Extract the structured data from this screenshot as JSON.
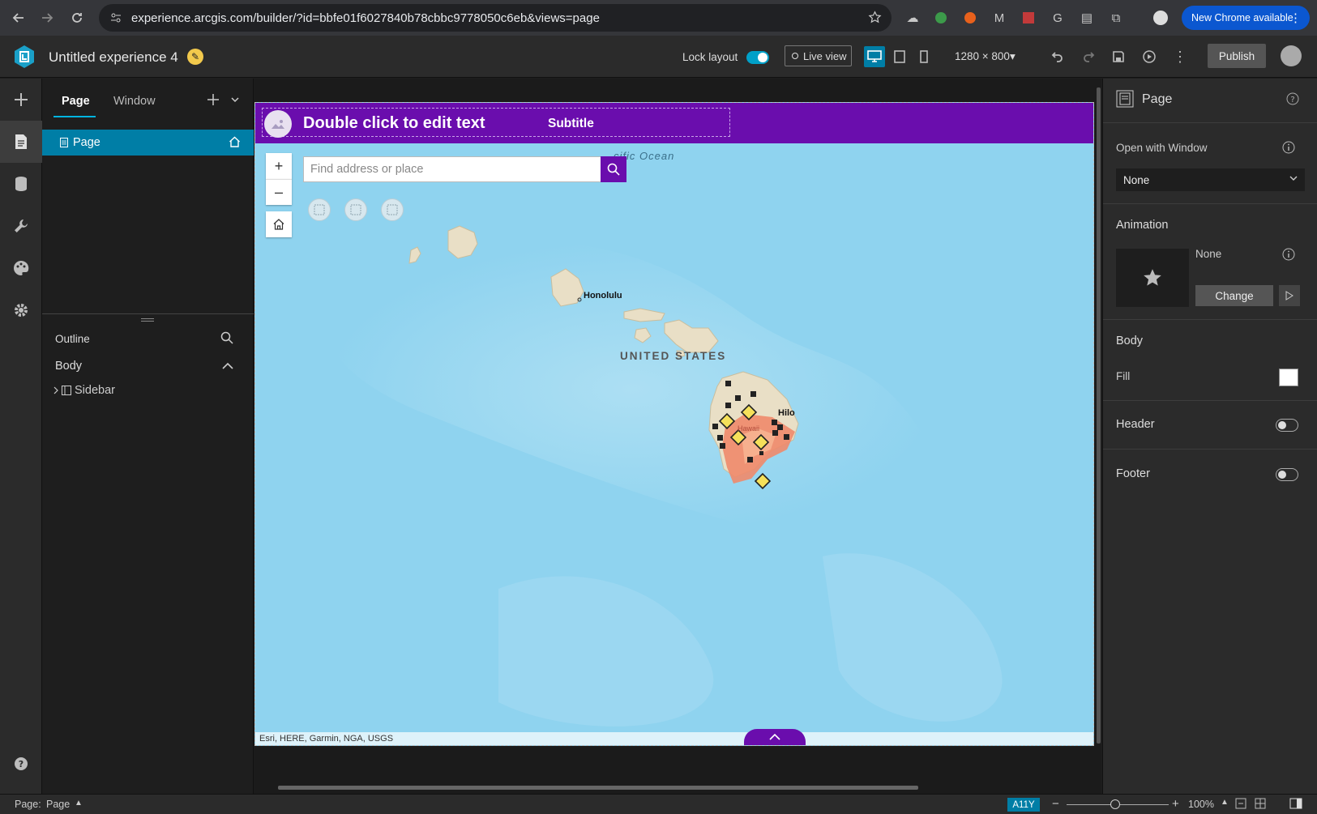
{
  "browser": {
    "url": "experience.arcgis.com/builder/?id=bbfe01f6027840b78cbbc9778050c6eb&views=page",
    "new_chrome": "New Chrome available"
  },
  "header": {
    "title": "Untitled experience 4",
    "lock_layout_label": "Lock layout",
    "lock_layout_on": true,
    "live_view_label": "Live view",
    "resolution": "1280 × 800",
    "publish_label": "Publish"
  },
  "left_panel": {
    "tabs": [
      {
        "label": "Page",
        "active": true
      },
      {
        "label": "Window",
        "active": false
      }
    ],
    "pages": [
      {
        "label": "Page",
        "is_home": true
      }
    ],
    "outline_label": "Outline",
    "body_label": "Body",
    "tree": [
      {
        "label": "Sidebar"
      }
    ]
  },
  "canvas": {
    "header_title": "Double click to edit text",
    "header_subtitle": "Subtitle",
    "search_placeholder": "Find address or place",
    "map_labels": {
      "ocean": "cific  Ocean",
      "honolulu": "Honolulu",
      "country": "UNITED STATES",
      "hilo": "Hilo",
      "island": "Hawaii"
    },
    "attribution": "Esri, HERE, Garmin, NGA, USGS",
    "accent_color": "#6a0dad",
    "water_color": "#8fd3ef"
  },
  "right_panel": {
    "title": "Page",
    "open_with_window_label": "Open with Window",
    "open_with_window_value": "None",
    "animation_label": "Animation",
    "animation_value": "None",
    "change_label": "Change",
    "body_label": "Body",
    "fill_label": "Fill",
    "fill_color": "#ffffff",
    "header_label": "Header",
    "header_on": false,
    "footer_label": "Footer",
    "footer_on": false
  },
  "status_bar": {
    "page_prefix": "Page:",
    "page_value": "Page",
    "a11y_label": "A11Y",
    "zoom": "100%"
  }
}
